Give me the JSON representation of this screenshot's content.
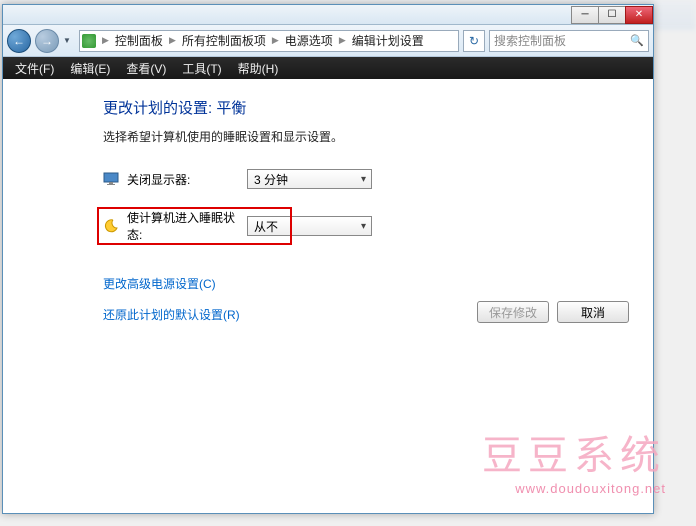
{
  "titlebar": {
    "minimize": "─",
    "maximize": "☐",
    "close": "✕"
  },
  "nav": {
    "back": "←",
    "forward": "→",
    "dropdown": "▼",
    "refresh": "↻"
  },
  "breadcrumb": {
    "items": [
      "控制面板",
      "所有控制面板项",
      "电源选项",
      "编辑计划设置"
    ]
  },
  "search": {
    "placeholder": "搜索控制面板",
    "icon": "🔍"
  },
  "menus": {
    "file": "文件(F)",
    "edit": "编辑(E)",
    "view": "查看(V)",
    "tools": "工具(T)",
    "help": "帮助(H)"
  },
  "content": {
    "heading": "更改计划的设置: 平衡",
    "subtext": "选择希望计算机使用的睡眠设置和显示设置。",
    "display_off_label": "关闭显示器:",
    "display_off_value": "3 分钟",
    "sleep_label": "使计算机进入睡眠状态:",
    "sleep_value": "从不",
    "advanced_link": "更改高级电源设置(C)",
    "restore_link": "还原此计划的默认设置(R)",
    "save_btn": "保存修改",
    "cancel_btn": "取消"
  },
  "watermark": {
    "brand": "豆豆系统",
    "url": "www.doudouxitong.net"
  }
}
